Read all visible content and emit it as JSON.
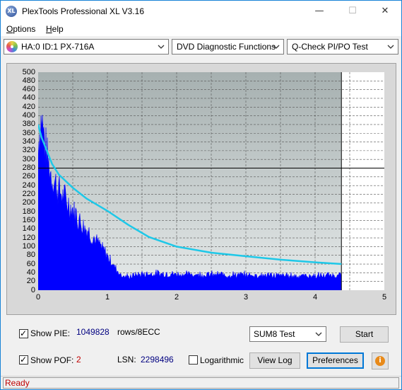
{
  "window": {
    "title": "PlexTools Professional XL V3.16",
    "icon_label": "XL",
    "minimize": "—",
    "maximize": "☐",
    "close": "✕"
  },
  "menu": {
    "options": "Options",
    "options_hotkey": "O",
    "options_rest": "ptions",
    "help": "Help",
    "help_hotkey": "H",
    "help_rest": "elp"
  },
  "toolbar": {
    "drive": "HA:0 ID:1  PX-716A",
    "function": "DVD Diagnostic Functions",
    "test": "Q-Check PI/PO Test"
  },
  "chart_data": {
    "type": "area",
    "title": "",
    "xlabel": "",
    "ylabel": "",
    "xlim": [
      0,
      5
    ],
    "ylim": [
      0,
      500
    ],
    "x_ticks": [
      "0",
      "1",
      "2",
      "3",
      "4",
      "5"
    ],
    "y_ticks": [
      "500",
      "480",
      "460",
      "440",
      "420",
      "400",
      "380",
      "360",
      "340",
      "320",
      "300",
      "280",
      "260",
      "240",
      "220",
      "200",
      "180",
      "160",
      "140",
      "120",
      "100",
      "80",
      "60",
      "40",
      "20",
      "0"
    ],
    "data_end_x": 4.38,
    "threshold_y": 280,
    "pie_series": {
      "color": "#0000ff",
      "x": [
        0,
        0.05,
        0.1,
        0.15,
        0.2,
        0.3,
        0.4,
        0.5,
        0.6,
        0.7,
        0.8,
        0.9,
        1.0,
        1.1,
        1.2,
        1.3,
        1.4,
        1.6,
        1.8,
        2.0,
        2.5,
        3.0,
        3.5,
        4.0,
        4.38
      ],
      "y": [
        340,
        400,
        330,
        290,
        260,
        230,
        205,
        185,
        160,
        140,
        120,
        100,
        80,
        55,
        35,
        30,
        35,
        38,
        38,
        37,
        36,
        35,
        34,
        33,
        35
      ]
    },
    "sum_series": {
      "color": "#1ec8e8",
      "x": [
        0,
        0.05,
        0.1,
        0.2,
        0.3,
        0.5,
        0.7,
        1.0,
        1.3,
        1.6,
        2.0,
        2.5,
        3.0,
        3.5,
        4.0,
        4.38
      ],
      "y": [
        380,
        350,
        330,
        290,
        265,
        235,
        210,
        182,
        150,
        122,
        100,
        86,
        78,
        70,
        64,
        60
      ]
    }
  },
  "controls": {
    "show_pie_label": "Show PIE:",
    "pie_value": "1049828",
    "rows_label": "rows/8ECC",
    "show_pof_label": "Show POF:",
    "pof_value": "2",
    "lsn_label": "LSN:",
    "lsn_value": "2298496",
    "logarithmic_label": "Logarithmic",
    "sum_select": "SUM8 Test",
    "start_button": "Start",
    "view_log_button": "View Log",
    "preferences_button": "Preferences",
    "info_icon": "i"
  },
  "status": {
    "text": "Ready"
  }
}
